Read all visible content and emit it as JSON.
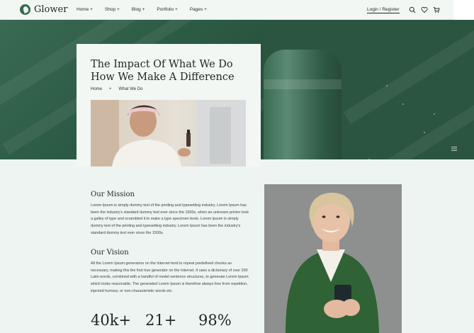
{
  "header": {
    "brand": "Glower",
    "nav": [
      {
        "label": "Home +"
      },
      {
        "label": "Shop +"
      },
      {
        "label": "Blog +"
      },
      {
        "label": "Portfolio +"
      },
      {
        "label": "Pages +"
      }
    ],
    "login_label": "Login / Register",
    "icons": [
      "search-icon",
      "heart-icon",
      "cart-icon",
      "menu-icon"
    ]
  },
  "hero": {
    "title": "The Impact Of What We Do How We Make A Difference",
    "breadcrumb": {
      "home": "Home",
      "separator": "+",
      "current": "What We Do"
    }
  },
  "mission": {
    "heading": "Our Mission",
    "text": "Lorem Ipsum is simply dummy text of the printing and typesetting industry. Lorem Ipsum has been the industry's standard dummy text ever since the 1500s, when an unknown printer took a galley of type and scrambled it to make a type specimen book. Lorem Ipsum is simply dummy text of the printing and typesetting industry. Lorem Ipsum has been the industry's standard dummy text ever since the 1500s."
  },
  "vision": {
    "heading": "Our Vision",
    "text": "All the Lorem Ipsum generators on the Internet tend to repeat predefined chunks as necessary, making this the first true generator on the Internet. It uses a dictionary of over 200 Latin words, combined with a handful of model sentence structures, to generate Lorem Ipsum which looks reasonable. The generated Lorem Ipsum is therefore always free from repetition, injected humour, or non-characteristic words etc."
  },
  "stats": [
    {
      "value": "40k+"
    },
    {
      "value": "21+"
    },
    {
      "value": "98%"
    }
  ],
  "colors": {
    "brand_green": "#2f6b4d",
    "hero_green": "#2b5541",
    "page_bg": "#eef4f1",
    "card_bg": "#f2f7f4"
  }
}
